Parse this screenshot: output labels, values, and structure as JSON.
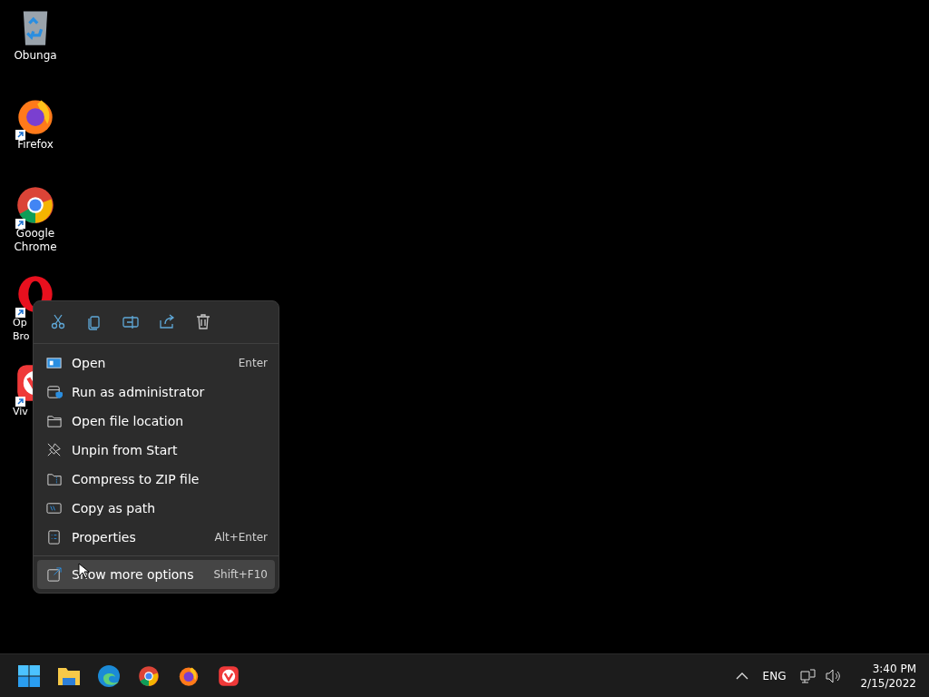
{
  "desktop_icons": [
    {
      "label_lines": [
        "Obunga"
      ],
      "shortcut": false
    },
    {
      "label_lines": [
        "Firefox"
      ],
      "shortcut": true
    },
    {
      "label_lines": [
        "Google",
        "Chrome"
      ],
      "shortcut": true
    },
    {
      "label_lines": [
        "Op",
        "Bro"
      ],
      "shortcut": true
    },
    {
      "label_lines": [
        "Viv"
      ],
      "shortcut": true
    }
  ],
  "context_menu": {
    "items": [
      {
        "label": "Open",
        "shortcut": "Enter",
        "selected": false
      },
      {
        "label": "Run as administrator",
        "selected": false
      },
      {
        "label": "Open file location",
        "selected": false
      },
      {
        "label": "Unpin from Start",
        "selected": false
      },
      {
        "label": "Compress to ZIP file",
        "selected": false
      },
      {
        "label": "Copy as path",
        "selected": false
      },
      {
        "label": "Properties",
        "shortcut": "Alt+Enter",
        "selected": false
      }
    ],
    "footer_item": {
      "label": "Show more options",
      "shortcut": "Shift+F10",
      "selected": true
    }
  },
  "taskbar": {
    "language": "ENG",
    "time": "3:40 PM",
    "date": "2/15/2022"
  }
}
